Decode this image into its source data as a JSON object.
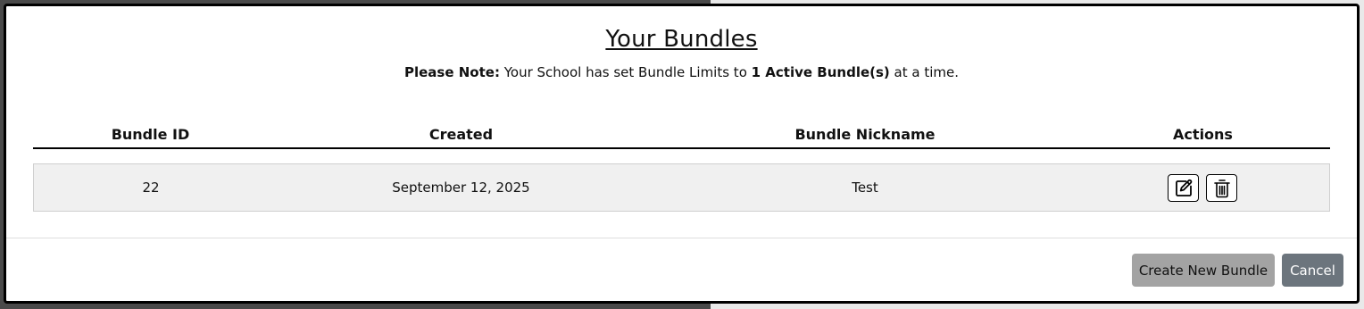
{
  "modal": {
    "title": "Your Bundles",
    "note_prefix": "Please Note:",
    "note_middle": " Your School has set Bundle Limits to ",
    "note_limit": "1 Active Bundle(s)",
    "note_suffix": " at a time."
  },
  "table": {
    "headers": [
      "Bundle ID",
      "Created",
      "Bundle Nickname",
      "Actions"
    ],
    "rows": [
      {
        "bundle_id": "22",
        "created": "September 12, 2025",
        "nickname": "Test"
      }
    ],
    "action_icons": [
      "edit-icon",
      "trash-icon"
    ]
  },
  "footer": {
    "create_label": "Create New Bundle",
    "cancel_label": "Cancel"
  }
}
